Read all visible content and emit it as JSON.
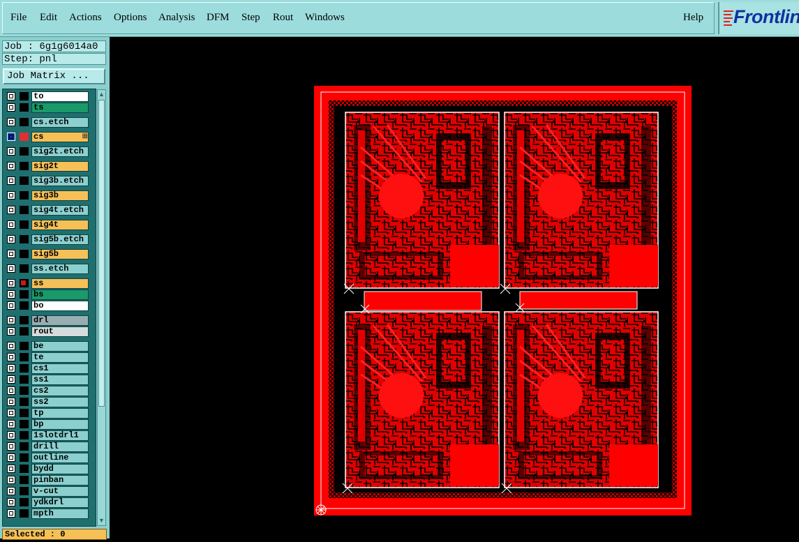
{
  "menu": {
    "items": [
      "File",
      "Edit",
      "Actions",
      "Options",
      "Analysis",
      "DFM",
      "Step",
      "Rout",
      "Windows"
    ],
    "help": "Help",
    "logo_text": "Frontline"
  },
  "job_info": {
    "job": "Job : 6g1g6014a0",
    "step": "Step: pnl"
  },
  "job_matrix_label": "Job Matrix ...",
  "layers": [
    {
      "name": "to",
      "color": "#ffffff"
    },
    {
      "name": "ts",
      "color": "#1a9a6a"
    },
    {
      "name": "cs.etch",
      "color": "#8ccfcf"
    },
    {
      "name": "cs",
      "color": "#f6c057",
      "active": true,
      "marker": "⊞"
    },
    {
      "name": "sig2t.etch",
      "color": "#8ccfcf"
    },
    {
      "name": "sig2t",
      "color": "#f6c057"
    },
    {
      "name": "sig3b.etch",
      "color": "#8ccfcf"
    },
    {
      "name": "sig3b",
      "color": "#f6c057"
    },
    {
      "name": "sig4t.etch",
      "color": "#8ccfcf"
    },
    {
      "name": "sig4t",
      "color": "#f6c057"
    },
    {
      "name": "sig5b.etch",
      "color": "#8ccfcf"
    },
    {
      "name": "sig5b",
      "color": "#f6c057"
    },
    {
      "name": "ss.etch",
      "color": "#8ccfcf"
    },
    {
      "name": "ss",
      "color": "#f6c057",
      "swatch": "#cc1818"
    },
    {
      "name": "bs",
      "color": "#1a9a6a"
    },
    {
      "name": "bo",
      "color": "#ffffff"
    },
    {
      "name": "drl",
      "color": "#9aaeb2"
    },
    {
      "name": "rout",
      "color": "#d6dcdc"
    },
    {
      "name": "be",
      "color": "#8ccfcf"
    },
    {
      "name": "te",
      "color": "#8ccfcf"
    },
    {
      "name": "cs1",
      "color": "#8ccfcf"
    },
    {
      "name": "ss1",
      "color": "#8ccfcf"
    },
    {
      "name": "cs2",
      "color": "#8ccfcf"
    },
    {
      "name": "ss2",
      "color": "#8ccfcf"
    },
    {
      "name": "tp",
      "color": "#8ccfcf"
    },
    {
      "name": "bp",
      "color": "#8ccfcf"
    },
    {
      "name": "1slotdrl1",
      "color": "#8ccfcf"
    },
    {
      "name": "drill",
      "color": "#8ccfcf"
    },
    {
      "name": "outline",
      "color": "#8ccfcf"
    },
    {
      "name": "bydd",
      "color": "#8ccfcf"
    },
    {
      "name": "pinban",
      "color": "#8ccfcf"
    },
    {
      "name": "v-cut",
      "color": "#8ccfcf"
    },
    {
      "name": "ydkdrl",
      "color": "#8ccfcf"
    },
    {
      "name": "mpth",
      "color": "#8ccfcf"
    }
  ],
  "selected_label": "Selected : 0",
  "colors": {
    "panel_bg": "#8ccfcf",
    "board_red": "#ff0000",
    "active_layer": "#f6c057"
  }
}
